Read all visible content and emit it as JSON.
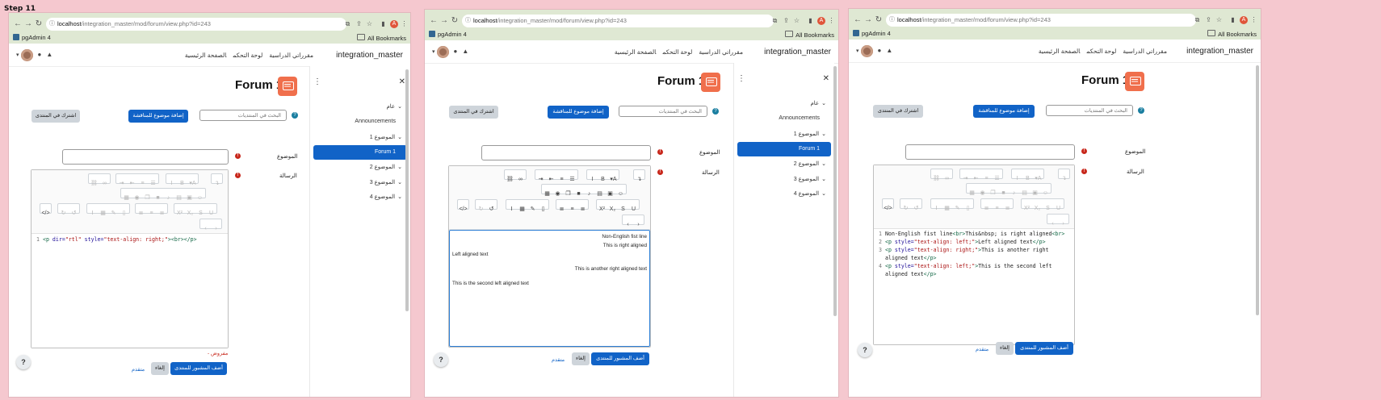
{
  "step_label": "Step 11",
  "browser": {
    "url_host": "localhost",
    "url_path": "/integration_master/mod/forum/view.php?id=243",
    "avatar_letter": "A",
    "bookmark_pgadmin": "pgAdmin 4",
    "bookmark_all": "All Bookmarks"
  },
  "site": {
    "name": "integration_master",
    "nav_home": "الصفحة الرئيسية",
    "nav_dashboard": "لوحة التحكم",
    "nav_courses": "مقرراتي الدراسية"
  },
  "drawer": {
    "general": "عام",
    "announcements": "Announcements",
    "topic1": "الموضوع 1",
    "forum1": "Forum 1",
    "topic2": "الموضوع 2",
    "topic3": "الموضوع 3",
    "topic4": "الموضوع 4"
  },
  "forum": {
    "title": "Forum 1",
    "search_placeholder": "البحث في المنتديات",
    "add_topic": "إضافة موضوع للمناقشة",
    "subscribe": "اشترك في المنتدى",
    "subject_label": "الموضوع",
    "message_label": "الرسالة",
    "required_note": "- مفروض",
    "post_button": "أضف المشبور للمنتدى",
    "cancel_button": "إلغاء",
    "advanced_link": "متقدم",
    "help": "?"
  },
  "panel1_code": {
    "line1_no": "1",
    "line1_open": "<p",
    "line1_attr1": " dir=",
    "line1_val1": "\"rtl\"",
    "line1_attr2": " style=",
    "line1_val2": "\"text-align: right;\"",
    "line1_close": "><br></p>"
  },
  "panel2_wysiwyg": {
    "line1": "Non-English fist line",
    "line2": "This  is right aligned",
    "line3": "Left aligned text",
    "line4": "This is another right aligned text",
    "line5": "This is the second left aligned text"
  },
  "panel3_code": {
    "l1_no": "1",
    "l1_text": "Non-English fist line",
    "l1_tag": "<br>",
    "l1_text2": "This&nbsp; is right aligned",
    "l1_tag2": "<br>",
    "l2_no": "2",
    "l2_open": "<p",
    "l2_attr": " style=",
    "l2_val": "\"text-align: left;\"",
    "l2_gt": ">",
    "l2_text": "Left aligned text",
    "l2_close": "</p>",
    "l3_no": "3",
    "l3_open": "<p",
    "l3_attr": " style=",
    "l3_val": "\"text-align: right;\"",
    "l3_gt": ">",
    "l3_text": "This is another right",
    "l3_text_cont": "aligned text",
    "l3_close": "</p>",
    "l4_no": "4",
    "l4_open": "<p",
    "l4_attr": " style=",
    "l4_val": "\"text-align: left;\"",
    "l4_gt": ">",
    "l4_text": "This is the second left",
    "l4_text_cont": "aligned text",
    "l4_close": "</p>"
  },
  "icons": [
    "back-icon",
    "forward-icon",
    "reload-icon",
    "lock-icon",
    "translate-icon",
    "share-icon",
    "star-icon",
    "sidepanel-icon",
    "menu-icon",
    "chat-icon",
    "bell-icon",
    "close-icon",
    "kebab-icon",
    "search-icon",
    "chevron-down-icon",
    "forum-icon",
    "help-icon",
    "error-icon"
  ],
  "colors": {
    "primary": "#1163c7",
    "forum_icon": "#f06f4c",
    "required": "#c8281c",
    "chrome": "#dfe8d3",
    "background": "#f5c8cf"
  }
}
